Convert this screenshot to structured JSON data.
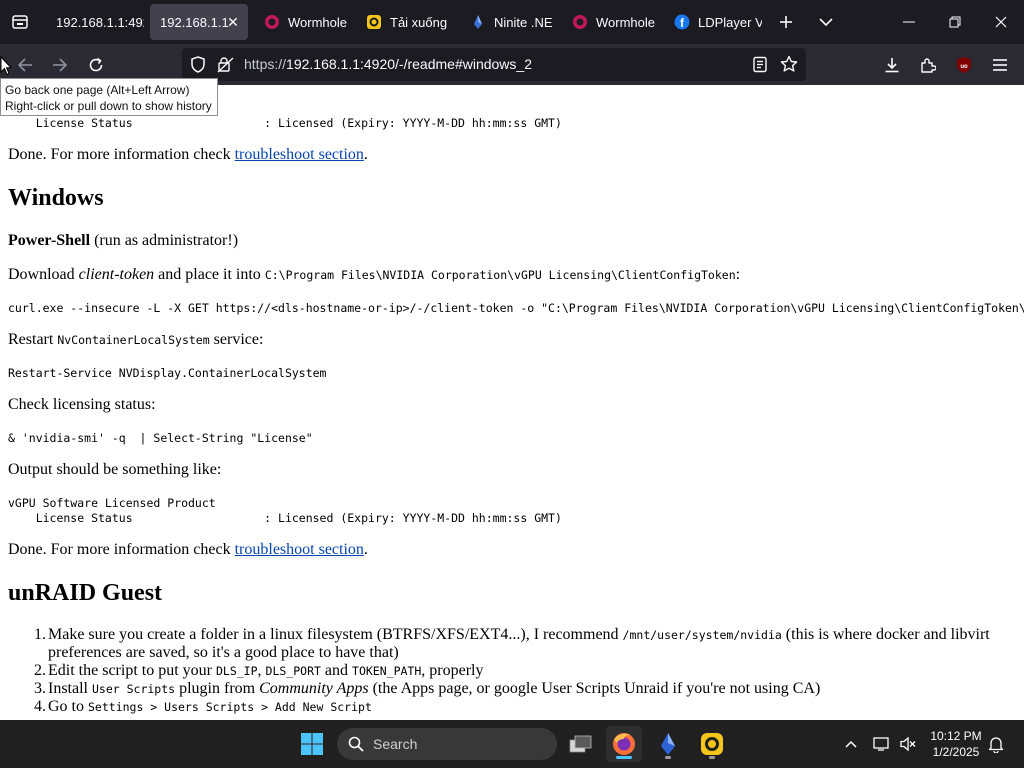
{
  "browser": {
    "tabs": [
      {
        "label": "192.168.1.1:492",
        "icon": "none",
        "active": false
      },
      {
        "label": "192.168.1.1:4",
        "icon": "none",
        "active": true
      },
      {
        "label": "Wormhole",
        "icon": "wormhole-icon",
        "active": false
      },
      {
        "label": "Tải xuống",
        "icon": "ldplayer-icon",
        "active": false
      },
      {
        "label": "Ninite .NE",
        "icon": "ninite-icon",
        "active": false
      },
      {
        "label": "Wormhole",
        "icon": "wormhole-icon",
        "active": false
      },
      {
        "label": "LDPlayer V",
        "icon": "facebook-icon",
        "active": false
      }
    ],
    "url": {
      "scheme": "https://",
      "host": "192.168.1.1",
      "path": ":4920/-/readme#windows_2"
    },
    "tooltip": {
      "line1": "Go back one page (Alt+Left Arrow)",
      "line2": "Right-click or pull down to show history"
    }
  },
  "page": {
    "top_license_line": "    License Status                   : Licensed (Expiry: YYYY-M-DD hh:mm:ss GMT)",
    "done1": {
      "prefix": "Done. For more information check ",
      "link": "troubleshoot section",
      "suffix": "."
    },
    "windows_heading": "Windows",
    "powershell": {
      "bold": "Power-Shell",
      "rest": " (run as administrator!)"
    },
    "download": {
      "prefix": "Download ",
      "emph": "client-token",
      "mid": " and place it into ",
      "path": "C:\\Program Files\\NVIDIA Corporation\\vGPU Licensing\\ClientConfigToken",
      "suffix": ":"
    },
    "curl_cmd": "curl.exe --insecure -L -X GET https://<dls-hostname-or-ip>/-/client-token -o \"C:\\Program Files\\NVIDIA Corporation\\vGPU Licensing\\ClientConfigToken\\client_configuration_token.tok\"",
    "restart": {
      "prefix": "Restart ",
      "code": "NvContainerLocalSystem",
      "suffix": " service:"
    },
    "restart_cmd": "Restart-Service NVDisplay.ContainerLocalSystem",
    "check_status": "Check licensing status:",
    "smi_cmd": "& 'nvidia-smi' -q  | Select-String \"License\"",
    "output_like": "Output should be something like:",
    "output_block": "vGPU Software Licensed Product\n    License Status                   : Licensed (Expiry: YYYY-M-DD hh:mm:ss GMT)",
    "done2": {
      "prefix": "Done. For more information check ",
      "link": "troubleshoot section",
      "suffix": "."
    },
    "unraid_heading": "unRAID Guest",
    "steps": [
      {
        "num": "1.",
        "t1": "Make sure you create a folder in a linux filesystem (BTRFS/XFS/EXT4...), I recommend ",
        "c1": "/mnt/user/system/nvidia",
        "t2": " (this is where docker and libvirt preferences are saved, so it's a good place to have that)"
      },
      {
        "num": "2.",
        "t1": "Edit the script to put your ",
        "c1": "DLS_IP",
        "t2": ", ",
        "c2": "DLS_PORT",
        "t3": " and ",
        "c3": "TOKEN_PATH",
        "t4": ", properly"
      },
      {
        "num": "3.",
        "t1": "Install ",
        "c1": "User Scripts",
        "t2": " plugin from ",
        "e1": "Community Apps",
        "t3": " (the Apps page, or google User Scripts Unraid if you're not using CA)"
      },
      {
        "num": "4.",
        "t1": "Go to ",
        "c1": "Settings > Users Scripts > Add New Script"
      }
    ]
  },
  "taskbar": {
    "search_label": "Search",
    "time": "10:12 PM",
    "date": "1/2/2025"
  },
  "colors": {
    "link": "#0645ad",
    "firefox_dark": "#1c1b22",
    "navbar": "#2b2a33",
    "taskbar": "#202020",
    "windows_blue": "#4cc2ff"
  }
}
